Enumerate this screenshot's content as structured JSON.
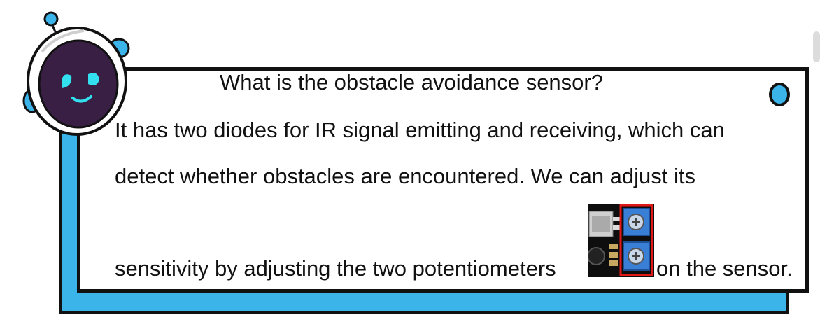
{
  "heading": "What is the obstacle avoidance sensor?",
  "body": {
    "line1": "It has two diodes for IR signal emitting and receiving, which can",
    "line2": "detect whether obstacles are encountered. We can adjust its",
    "line3_start": "sensitivity by adjusting the two potentiometers",
    "line3_end": "on the sensor."
  },
  "colors": {
    "accent": "#3bb4ea",
    "border": "#111111",
    "highlight": "#e01818",
    "potentiometer": "#3a7fd6"
  },
  "icons": {
    "mascot": "robot-mascot-icon",
    "sensor": "potentiometer-sensor-image"
  }
}
